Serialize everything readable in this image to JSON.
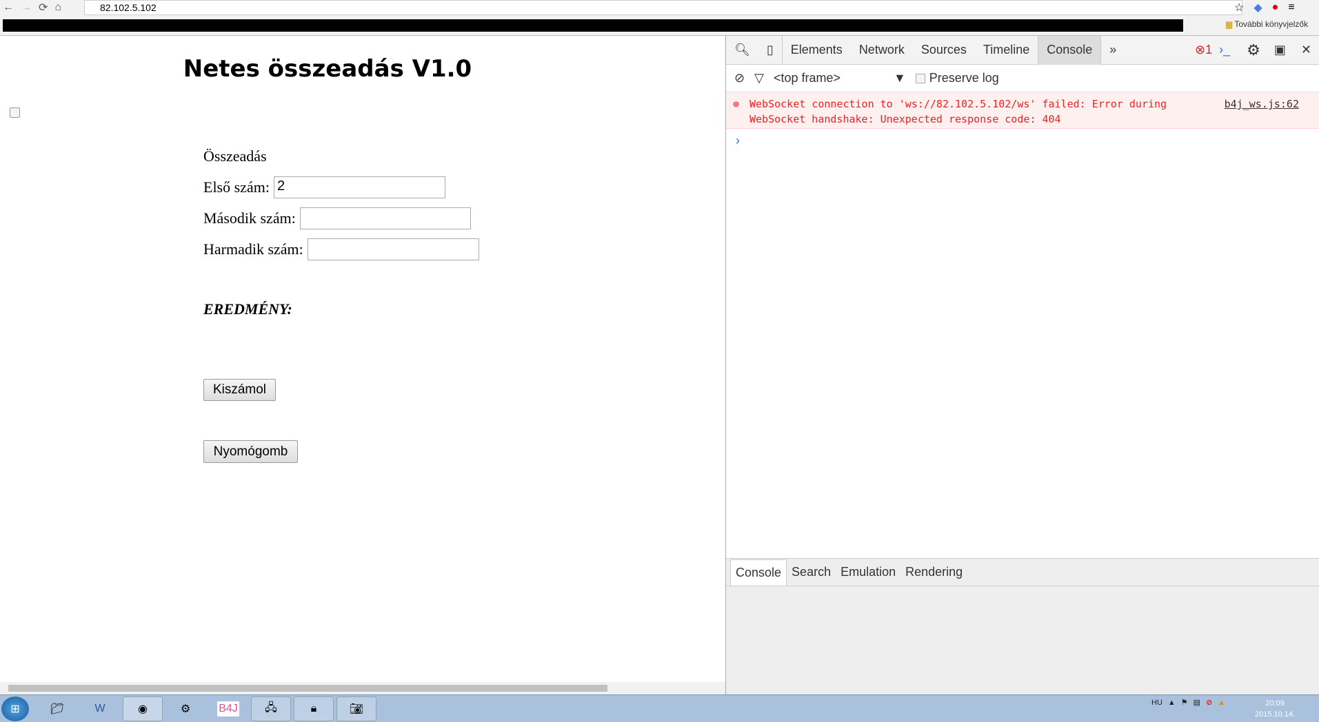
{
  "browser": {
    "url": "82.102.5.102",
    "more_bookmarks": "További könyvjelzők"
  },
  "page": {
    "title": "Netes összeadás V1.0",
    "section": "Összeadás",
    "fields": [
      {
        "label": "Első szám:",
        "value": "2"
      },
      {
        "label": "Második szám:",
        "value": ""
      },
      {
        "label": "Harmadik szám:",
        "value": ""
      }
    ],
    "result_label": "EREDMÉNY:",
    "calc_button": "Kiszámol",
    "push_button": "Nyomógomb"
  },
  "devtools": {
    "tabs": [
      "Elements",
      "Network",
      "Sources",
      "Timeline",
      "Console"
    ],
    "more": "»",
    "error_count": "1",
    "frame_select": "<top frame>",
    "preserve_log": "Preserve log",
    "error": {
      "message": "WebSocket connection to 'ws://82.102.5.102/ws' failed: Error during WebSocket handshake: Unexpected response code: 404",
      "source": "b4j_ws.js:62"
    },
    "prompt": "›",
    "drawer_tabs": [
      "Console",
      "Search",
      "Emulation",
      "Rendering"
    ]
  },
  "taskbar": {
    "lang": "HU",
    "time": "20:09",
    "date": "2015.10.14.",
    "b4j_label": "B4J"
  }
}
